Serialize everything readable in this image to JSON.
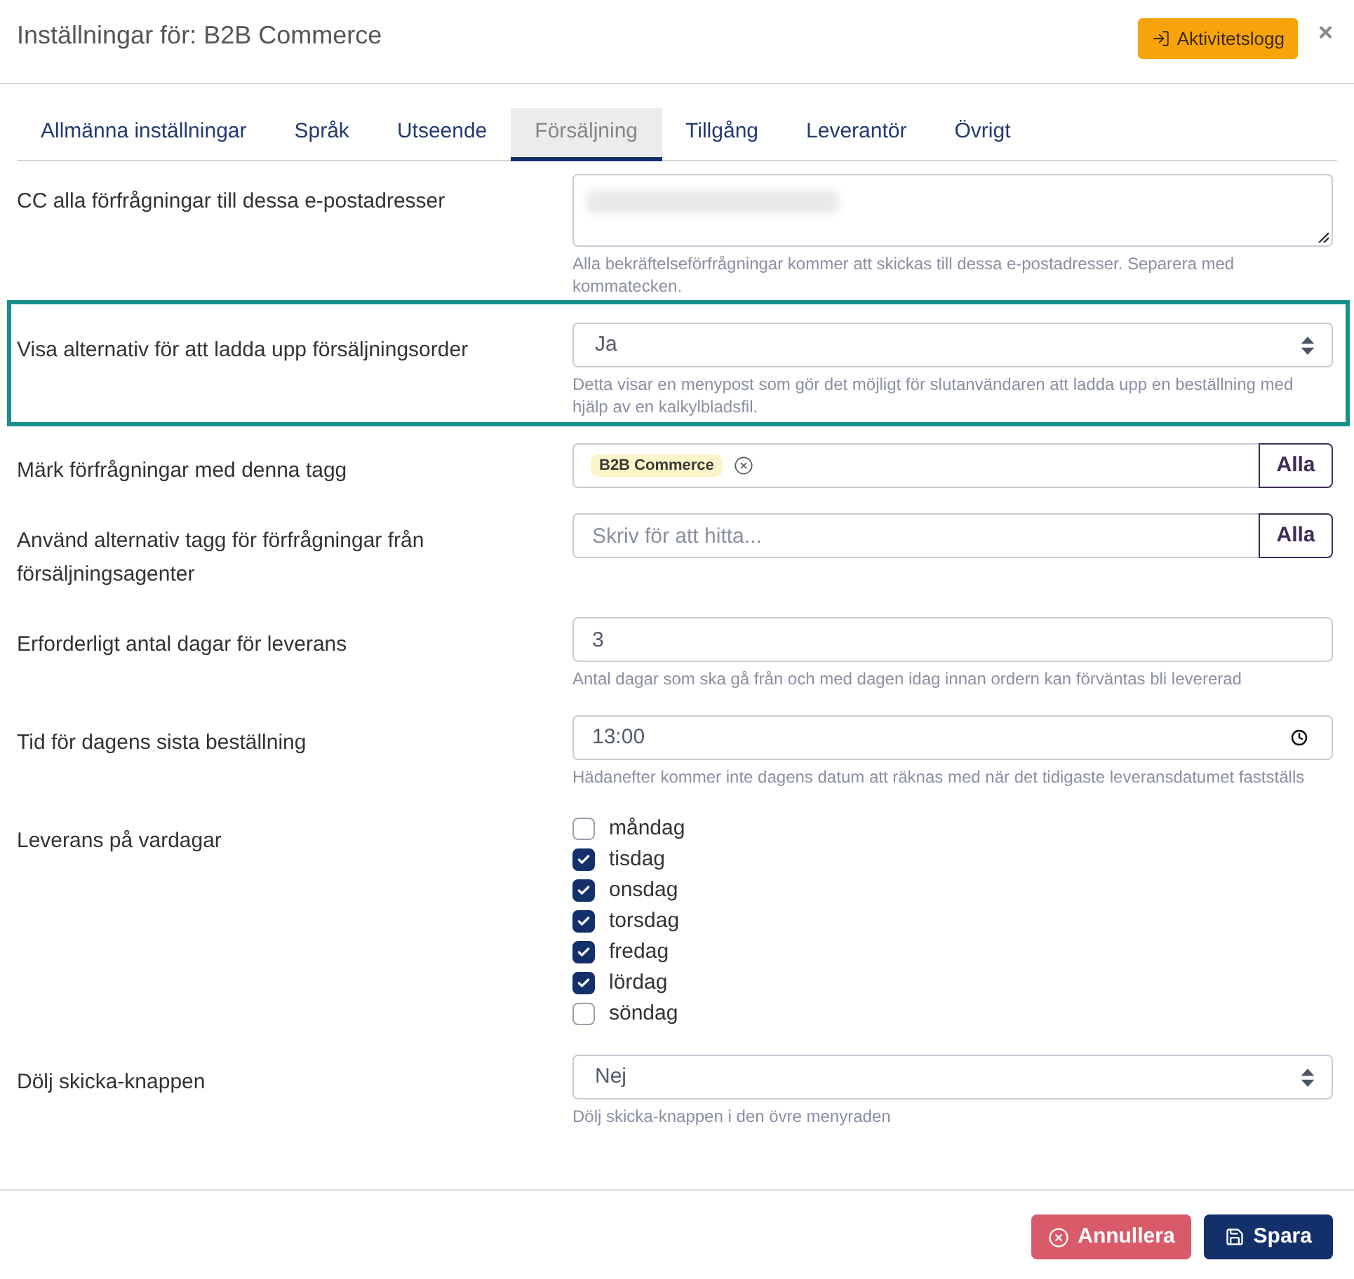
{
  "dialog": {
    "title": "Inställningar för: B2B Commerce",
    "activity_log_button": "Aktivitetslogg",
    "close": "×"
  },
  "tabs": [
    {
      "label": "Allmänna inställningar",
      "selected": false
    },
    {
      "label": "Språk",
      "selected": false
    },
    {
      "label": "Utseende",
      "selected": false
    },
    {
      "label": "Försäljning",
      "selected": true
    },
    {
      "label": "Tillgång",
      "selected": false
    },
    {
      "label": "Leverantör",
      "selected": false
    },
    {
      "label": "Övrigt",
      "selected": false
    }
  ],
  "settings": [
    {
      "kind": "textarea",
      "label": "CC alla förfrågningar till dessa e-postadresser",
      "redacted": true,
      "help": "Alla bekräftelseförfrågningar kommer att skickas till dessa e-postadresser. Separera med kommatecken.",
      "highlighted": false
    },
    {
      "kind": "select",
      "label": "Visa alternativ för att ladda upp försäljningsorder",
      "value": "Ja",
      "help": "Detta visar en menypost som gör det möjligt för slutanvändaren att ladda upp en beställning med hjälp av en kalkylbladsfil.",
      "highlighted": true
    },
    {
      "kind": "tags",
      "label": "Märk förfrågningar med denna tagg",
      "tags": [
        "B2B Commerce"
      ],
      "button": "Alla",
      "highlighted": false
    },
    {
      "kind": "tags",
      "label": "Använd alternativ tagg för förfrågningar från försäljningsagenter",
      "placeholder": "Skriv för att hitta...",
      "button": "Alla",
      "highlighted": false
    },
    {
      "kind": "text",
      "label": "Erforderligt antal dagar för leverans",
      "value": "3",
      "help": "Antal dagar som ska gå från och med dagen idag innan ordern kan förväntas bli levererad",
      "highlighted": false
    },
    {
      "kind": "time",
      "label": "Tid för dagens sista beställning",
      "value": "13:00",
      "help": "Hädanefter kommer inte dagens datum att räknas med när det tidigaste leveransdatumet fastställs",
      "highlighted": false
    },
    {
      "kind": "checkboxes",
      "label": "Leverans på vardagar",
      "options": [
        {
          "label": "måndag",
          "checked": false
        },
        {
          "label": "tisdag",
          "checked": true
        },
        {
          "label": "onsdag",
          "checked": true
        },
        {
          "label": "torsdag",
          "checked": true
        },
        {
          "label": "fredag",
          "checked": true
        },
        {
          "label": "lördag",
          "checked": true
        },
        {
          "label": "söndag",
          "checked": false
        }
      ],
      "highlighted": false
    },
    {
      "kind": "select",
      "label": "Dölj skicka-knappen",
      "value": "Nej",
      "help": "Dölj skicka-knappen i den övre menyraden",
      "highlighted": false
    }
  ],
  "footer": {
    "cancel": "Annullera",
    "save": "Spara"
  }
}
